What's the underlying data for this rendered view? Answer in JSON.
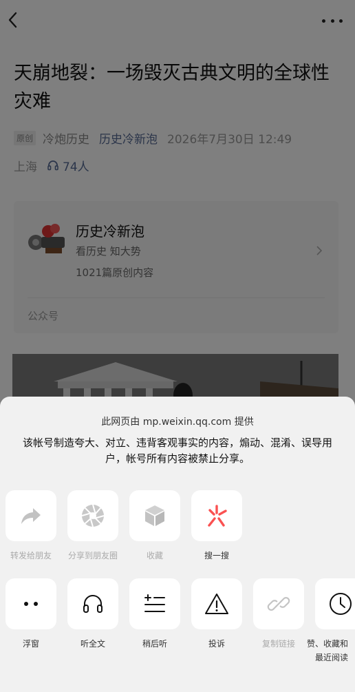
{
  "article": {
    "title": "天崩地裂：一场毁灭古典文明的全球性灾难",
    "original_tag": "原创",
    "author": "冷炮历史",
    "account_name": "历史冷新泡",
    "date": "2026年7月30日 12:49",
    "location": "上海",
    "listeners": "74人"
  },
  "account_card": {
    "name": "历史冷新泡",
    "slogan": "看历史 知大势",
    "count": "1021篇原创内容",
    "type": "公众号"
  },
  "sheet": {
    "provider": "此网页由 mp.weixin.qq.com 提供",
    "warning": "该帐号制造夸大、对立、违背客观事实的内容，煽动、混淆、误导用户，帐号所有内容被禁止分享。",
    "row1": [
      {
        "label": "转发给朋友",
        "icon": "forward-icon",
        "disabled": true
      },
      {
        "label": "分享到朋友圈",
        "icon": "moments-icon",
        "disabled": true
      },
      {
        "label": "收藏",
        "icon": "favorite-cube-icon",
        "disabled": true
      },
      {
        "label": "搜一搜",
        "icon": "search-one-search-icon",
        "disabled": false
      }
    ],
    "row2": [
      {
        "label": "浮窗",
        "icon": "float-window-icon",
        "disabled": false
      },
      {
        "label": "听全文",
        "icon": "headphones-icon",
        "disabled": false
      },
      {
        "label": "稍后听",
        "icon": "listen-later-icon",
        "disabled": false
      },
      {
        "label": "投诉",
        "icon": "warning-triangle-icon",
        "disabled": false
      },
      {
        "label": "复制链接",
        "icon": "link-icon",
        "disabled": true
      },
      {
        "label": "赞、收藏和",
        "label2": "最近阅读",
        "icon": "clock-icon",
        "disabled": false
      }
    ]
  },
  "colors": {
    "link_blue": "#576b95",
    "search_red": "#fa5151",
    "sheet_bg": "#f1f1f1"
  }
}
